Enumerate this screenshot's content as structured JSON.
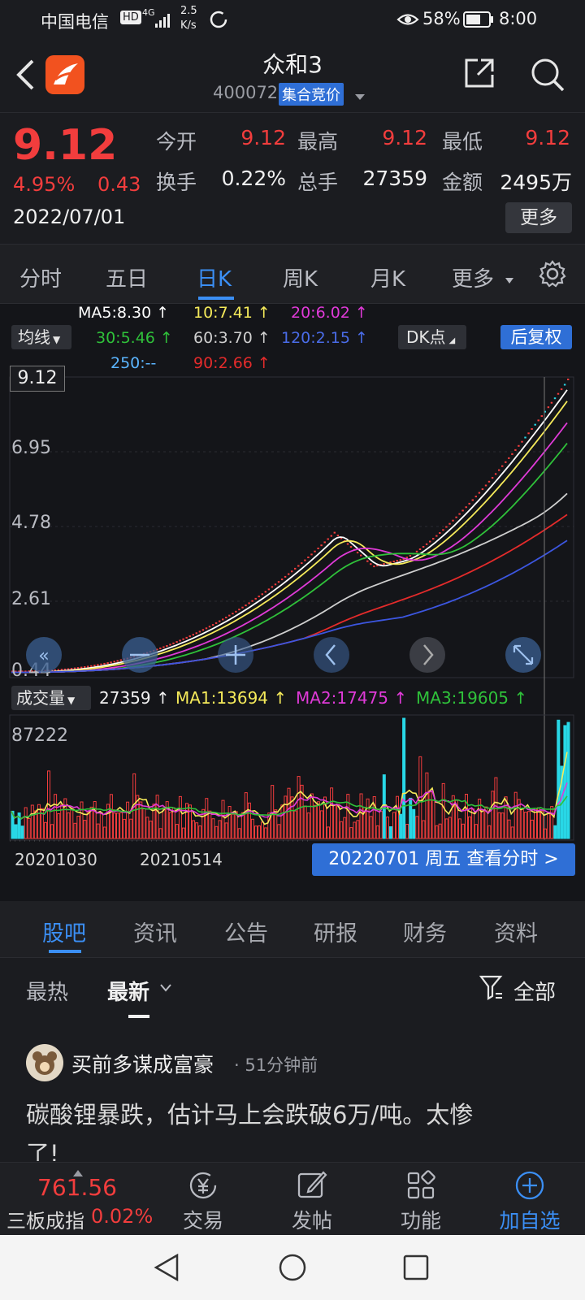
{
  "status_bar": {
    "carrier": "中国电信",
    "hd": "HD",
    "net": "4G",
    "speed_top": "2.5",
    "speed_bottom": "K/s",
    "battery": "58%",
    "time": "8:00"
  },
  "header": {
    "stock_name": "众和3",
    "stock_code": "400072",
    "auction_badge": "集合竞价"
  },
  "quote": {
    "price": "9.12",
    "change_pct": "4.95%",
    "change_abs": "0.43",
    "date": "2022/07/01",
    "open_label": "今开",
    "open_value": "9.12",
    "high_label": "最高",
    "high_value": "9.12",
    "low_label": "最低",
    "low_value": "9.12",
    "turnover_label": "换手",
    "turnover_value": "0.22%",
    "volume_label": "总手",
    "volume_value": "27359",
    "amount_label": "金额",
    "amount_value": "2495万",
    "more_button": "更多"
  },
  "period_tabs": [
    "分时",
    "五日",
    "日K",
    "周K",
    "月K",
    "更多"
  ],
  "period_tabs_active": "日K",
  "ma_legend": {
    "ma5": "MA5:8.30 ↑",
    "ma10": "10:7.41 ↑",
    "ma20": "20:6.02 ↑",
    "ma30": "30:5.46 ↑",
    "ma60": "60:3.70 ↑",
    "ma120": "120:2.15 ↑",
    "ma250": "250:--",
    "ma90": "90:2.66 ↑",
    "ma_select": "均线",
    "dk_button": "DK点",
    "adjust_button": "后复权"
  },
  "price_axis": {
    "current_tag": "9.12",
    "labels": [
      "9.12",
      "6.95",
      "4.78",
      "2.61",
      "0.44"
    ]
  },
  "volume_legend": {
    "select": "成交量",
    "vol": "27359 ↑",
    "ma1": "MA1:13694 ↑",
    "ma2": "MA2:17475 ↑",
    "ma3": "MA3:19605 ↑",
    "max_label": "87222"
  },
  "date_axis": {
    "start": "20201030",
    "mid": "20210514",
    "tooltip": "20220701 周五 查看分时 >"
  },
  "news_tabs": [
    "股吧",
    "资讯",
    "公告",
    "研报",
    "财务",
    "资料"
  ],
  "news_tabs_active": "股吧",
  "feed_filter": {
    "hot": "最热",
    "latest": "最新",
    "all": "全部"
  },
  "post": {
    "author": "买前多谋成富豪",
    "time": "· 51分钟前",
    "content_line1": "碳酸锂暴跌，估计马上会跌破6万/吨。太惨",
    "content_line2": "了!"
  },
  "bottom_nav": {
    "index_value": "761.56",
    "index_name": "三板成指",
    "index_change": "0.02%",
    "trade": "交易",
    "post": "发帖",
    "function": "功能",
    "watchlist": "加自选"
  },
  "colors": {
    "up": "#f23d3d",
    "down": "#28d7e6",
    "accent": "#3b8ff5",
    "ma5": "#ffffff",
    "ma10": "#f5ea5a",
    "ma20": "#e03ad8",
    "ma30": "#2fc13a",
    "ma60": "#cfcfcf",
    "ma90": "#e42b2b",
    "ma120": "#3c56e0",
    "ma250": "#5bb5ff"
  },
  "chart_data": {
    "type": "candlestick",
    "price_labels": [
      9.12,
      6.95,
      4.78,
      2.61,
      0.44
    ],
    "ylim": [
      0.44,
      9.12
    ],
    "last_close": 9.12,
    "volume_max_label": 87222,
    "x_labels": [
      "20201030",
      "20210514"
    ],
    "selected_date": "20220701"
  }
}
